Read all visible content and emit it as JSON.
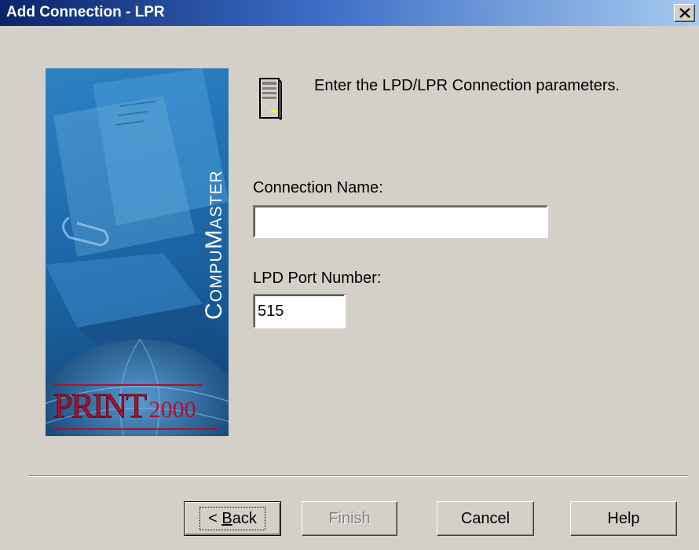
{
  "window": {
    "title": "Add Connection - LPR"
  },
  "banner": {
    "brand_text": "CompuMaster",
    "product_text": "PRINT",
    "product_suffix": "2000"
  },
  "intro": {
    "text": "Enter the LPD/LPR Connection parameters.",
    "icon": "server-icon"
  },
  "connection_name": {
    "label": "Connection Name:",
    "value": ""
  },
  "port": {
    "label": "LPD Port Number:",
    "value": "515"
  },
  "buttons": {
    "back_prefix": "< ",
    "back_mnemonic": "B",
    "back_rest": "ack",
    "finish": "Finish",
    "cancel": "Cancel",
    "help": "Help"
  },
  "colors": {
    "titlebar_start": "#0a246a",
    "titlebar_end": "#a6caf0",
    "dialog_bg": "#d4d0c8",
    "banner_blue": "#1f6eb0",
    "logo_red": "#b0102a"
  }
}
